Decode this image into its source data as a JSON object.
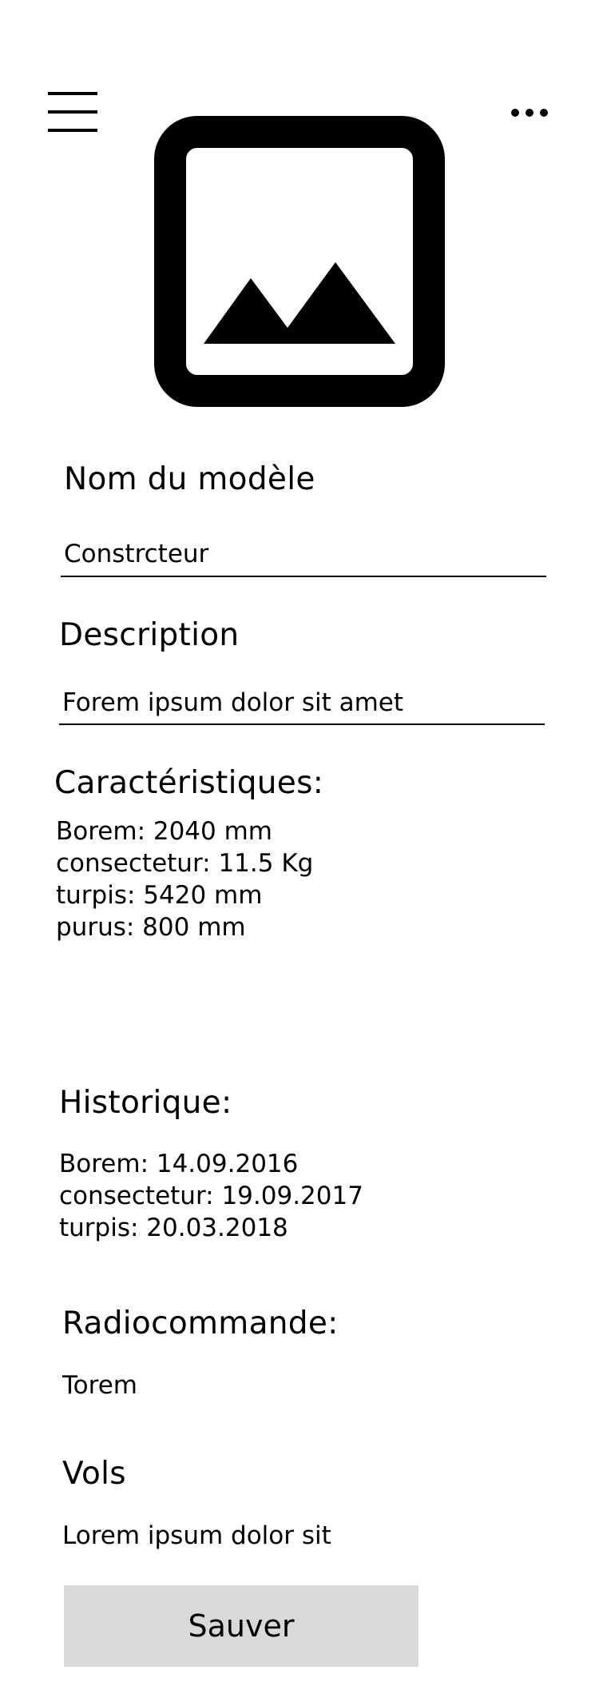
{
  "header": {
    "menu_icon": "hamburger-menu-icon",
    "more_icon": "more-options-icon",
    "image_icon": "image-placeholder-icon"
  },
  "form": {
    "model_name_label": "Nom du modèle",
    "manufacturer_value": "Constrcteur",
    "description_label": "Description",
    "description_value": "Forem ipsum dolor sit amet"
  },
  "characteristics": {
    "title": "Caractéristiques:",
    "items": [
      "Borem: 2040 mm",
      "consectetur:  11.5 Kg",
      "turpis: 5420 mm",
      "purus: 800 mm"
    ]
  },
  "history": {
    "title": "Historique:",
    "items": [
      "Borem: 14.09.2016",
      "consectetur:  19.09.2017",
      "turpis: 20.03.2018"
    ]
  },
  "radio": {
    "title": "Radiocommande:",
    "value": "Torem"
  },
  "flights": {
    "title": "Vols",
    "value": "Lorem ipsum dolor sit"
  },
  "actions": {
    "save_label": "Sauver"
  }
}
